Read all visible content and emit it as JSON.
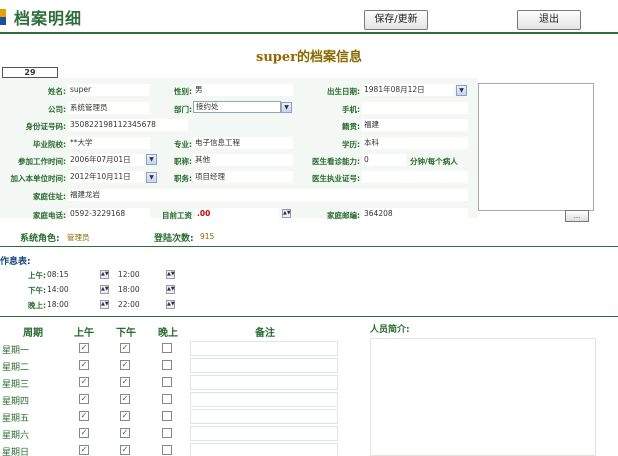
{
  "header": {
    "title": "档案明细",
    "save_button": "保存/更新",
    "exit_button": "退出"
  },
  "page": {
    "heading_name": "super",
    "heading_suffix": "的档案信息",
    "record_id": "29"
  },
  "form": {
    "name_label": "姓名:",
    "name_value": "super",
    "gender_label": "性别:",
    "gender_value": "男",
    "birth_label": "出生日期:",
    "birth_value": "1981年08月12日",
    "company_label": "公司:",
    "company_value": "系统管理员",
    "dept_label": "部门:",
    "dept_value": "接约处",
    "mobile_label": "手机:",
    "mobile_value": "",
    "idcard_label": "身份证号码:",
    "idcard_value": "350822198112345678",
    "native_label": "籍贯:",
    "native_value": "福建",
    "school_label": "毕业院校:",
    "school_value": "**大学",
    "major_label": "专业:",
    "major_value": "电子信息工程",
    "edu_label": "学历:",
    "edu_value": "本科",
    "workstart_label": "参加工作时间:",
    "workstart_value": "2006年07月01日",
    "title_label": "职称:",
    "title_value": "其他",
    "capacity_label": "医生看诊能力:",
    "capacity_value": "0",
    "capacity_unit": "分钟/每个病人",
    "join_label": "加入本单位时间:",
    "join_value": "2012年10月11日",
    "position_label": "职务:",
    "position_value": "项目经理",
    "license_label": "医生执业证号:",
    "license_value": "",
    "address_label": "家庭住址:",
    "address_value": "福建龙岩",
    "phone_label": "家庭电话:",
    "phone_value": "0592-3229168",
    "salary_label": "目前工资",
    "salary_value": ".00",
    "postcode_label": "家庭邮编:",
    "postcode_value": "364208",
    "photo_button": "..."
  },
  "system": {
    "role_label": "系统角色:",
    "role_value": "管理员",
    "login_label": "登陆次数:",
    "login_value": "915"
  },
  "schedule": {
    "title": "作息表:",
    "rows": [
      {
        "label": "上午:",
        "start": "08:15",
        "end": "12:00"
      },
      {
        "label": "下午:",
        "start": "14:00",
        "end": "18:00"
      },
      {
        "label": "晚上:",
        "start": "18:00",
        "end": "22:00"
      }
    ]
  },
  "weekly": {
    "headers": [
      "周期",
      "上午",
      "下午",
      "晚上",
      "备注"
    ],
    "days": [
      {
        "day": "星期一",
        "am": true,
        "pm": true,
        "eve": false
      },
      {
        "day": "星期二",
        "am": true,
        "pm": true,
        "eve": false
      },
      {
        "day": "星期三",
        "am": true,
        "pm": true,
        "eve": false
      },
      {
        "day": "星期四",
        "am": true,
        "pm": true,
        "eve": false
      },
      {
        "day": "星期五",
        "am": true,
        "pm": true,
        "eve": false
      },
      {
        "day": "星期六",
        "am": true,
        "pm": true,
        "eve": false
      },
      {
        "day": "星期日",
        "am": true,
        "pm": true,
        "eve": false
      }
    ],
    "intro_label": "人员简介:"
  },
  "colors": {
    "accent": "#2f6e3b",
    "label": "#2a6b2f",
    "heading": "#8a6a00"
  }
}
